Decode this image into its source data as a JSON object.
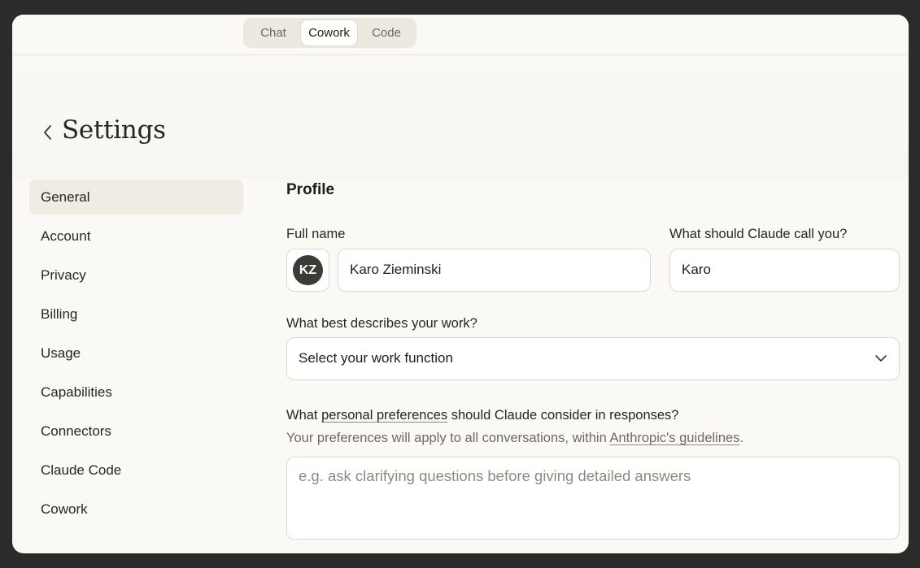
{
  "mode_switch": {
    "tabs": [
      {
        "label": "Chat"
      },
      {
        "label": "Cowork"
      },
      {
        "label": "Code"
      }
    ],
    "active": "Cowork"
  },
  "page": {
    "title": "Settings"
  },
  "sidebar": {
    "items": [
      {
        "label": "General"
      },
      {
        "label": "Account"
      },
      {
        "label": "Privacy"
      },
      {
        "label": "Billing"
      },
      {
        "label": "Usage"
      },
      {
        "label": "Capabilities"
      },
      {
        "label": "Connectors"
      },
      {
        "label": "Claude Code"
      },
      {
        "label": "Cowork"
      }
    ],
    "active": "General"
  },
  "profile": {
    "section_title": "Profile",
    "full_name_label": "Full name",
    "avatar_initials": "KZ",
    "full_name_value": "Karo Zieminski",
    "nickname_label": "What should Claude call you?",
    "nickname_value": "Karo",
    "work_label": "What best describes your work?",
    "work_select_value": "Select your work function",
    "prefs_label_pre": "What ",
    "prefs_label_link": "personal preferences",
    "prefs_label_post": " should Claude consider in responses?",
    "prefs_sub_pre": "Your preferences will apply to all conversations, within ",
    "prefs_sub_link": "Anthropic's guidelines",
    "prefs_sub_post": ".",
    "prefs_placeholder": "e.g. ask clarifying questions before giving detailed answers"
  }
}
